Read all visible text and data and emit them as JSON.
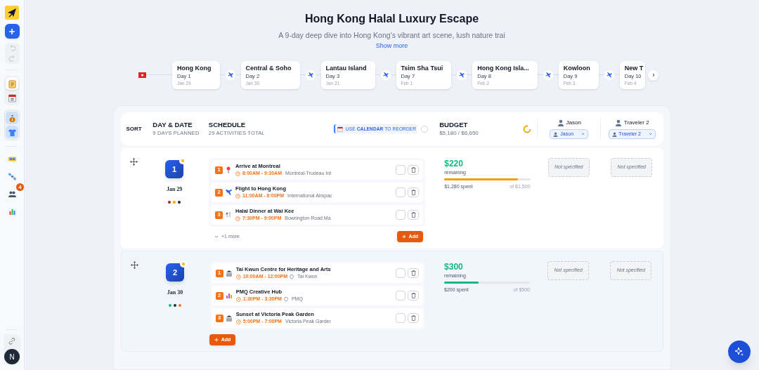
{
  "sidebar": {
    "history": [
      {
        "kind": "undo",
        "disabled": true
      },
      {
        "kind": "redo",
        "disabled": true
      }
    ],
    "views": [
      {
        "kind": "notes",
        "selected": true
      },
      {
        "kind": "calendar",
        "selected": false
      }
    ],
    "panels": [
      {
        "kind": "money",
        "selected": true
      },
      {
        "kind": "shirt",
        "selected": true
      }
    ],
    "tools": [
      {
        "kind": "tickets"
      },
      {
        "kind": "satellite"
      },
      {
        "kind": "people",
        "badge": "4"
      },
      {
        "kind": "chart"
      }
    ],
    "avatar": "N"
  },
  "trip": {
    "title": "Hong Kong Halal Luxury Escape",
    "description": "A 9-day deep dive into Hong Kong's vibrant art scene, lush nature trai",
    "show_more": "Show more"
  },
  "timeline": {
    "stops": [
      {
        "name": "Hong Kong",
        "day": "Day 1",
        "date": "Jan 29"
      },
      {
        "name": "Central & Soho",
        "day": "Day 2",
        "date": "Jan 30"
      },
      {
        "name": "Lantau Island",
        "day": "Day 3",
        "date": "Jan 31"
      },
      {
        "name": "Tsim Sha Tsui",
        "day": "Day 7",
        "date": "Feb 1"
      },
      {
        "name": "Hong Kong Isla...",
        "day": "Day 8",
        "date": "Feb 2"
      },
      {
        "name": "Kowloon",
        "day": "Day 9",
        "date": "Feb 3"
      },
      {
        "name": "New T",
        "day": "Day 10",
        "date": "Feb 4"
      }
    ]
  },
  "header": {
    "sort": "SORT",
    "day_title": "DAY & DATE",
    "day_sub": "9 DAYS PLANNED",
    "schedule_title": "SCHEDULE",
    "schedule_sub": "29 ACTIVITIES TOTAL",
    "calendar_hint": "USE **CALENDAR** TO REORDER",
    "calendar_toggle": false,
    "budget_title": "BUDGET",
    "budget_total": "$5,180 / $6,650",
    "travelers": [
      {
        "name": "Jason",
        "option": "Jason"
      },
      {
        "name": "Traveler 2",
        "option": "Traveler 2"
      }
    ]
  },
  "days": [
    {
      "number": "1",
      "date": "Jan 29",
      "highlighted": false,
      "dots": [
        {
          "color": "#b91c1c"
        },
        {
          "color": "#f59e0b"
        },
        {
          "color": "#1f2937"
        }
      ],
      "activities": [
        {
          "index": "1",
          "kind": "arrival",
          "title": "Arrive at Montreal",
          "time": "8:00AM - 9:30AM",
          "location": "Montréal-Trudeau Int",
          "pin": false,
          "done": false
        },
        {
          "index": "2",
          "kind": "flight",
          "title": "Flight to Hong Kong",
          "time": "11:00AM - 6:00PM",
          "location": "International Airspac",
          "pin": false,
          "done": false
        },
        {
          "index": "3",
          "kind": "dining",
          "title": "Halal Dinner at Wai Kee",
          "time": "7:30PM - 9:00PM",
          "location": "Bowrington Road Ma",
          "pin": false,
          "done": false
        }
      ],
      "more": "+1 more",
      "add": "Add",
      "budget": {
        "amount": "$220",
        "label": "remaining",
        "level": 0.853,
        "color": "#f59e0b",
        "spent": "$1,280 spent",
        "limit": "of $1,500"
      },
      "travelers": [
        "Not specified",
        "Not specified"
      ]
    },
    {
      "number": "2",
      "date": "Jan 30",
      "highlighted": true,
      "dots": [
        {
          "color": "#10b981"
        },
        {
          "color": "#1f2937"
        },
        {
          "color": "#f97316"
        }
      ],
      "activities": [
        {
          "index": "1",
          "kind": "museum",
          "title": "Tai Kwun Centre for Heritage and Arts",
          "time": "10:00AM - 12:00PM",
          "location": "Tai Kwun",
          "pin": true,
          "done": false
        },
        {
          "index": "2",
          "kind": "shopping",
          "title": "PMQ Creative Hub",
          "time": "1:30PM - 3:30PM",
          "location": "PMQ",
          "pin": true,
          "done": false
        },
        {
          "index": "3",
          "kind": "museum",
          "title": "Sunset at Victoria Peak Garden",
          "time": "5:00PM - 7:00PM",
          "location": "Victoria Peak Garder",
          "pin": false,
          "done": false
        }
      ],
      "add": "Add",
      "budget": {
        "amount": "$300",
        "label": "remaining",
        "level": 0.4,
        "color": "#10b981",
        "spent": "$200 spent",
        "limit": "of $500"
      },
      "travelers": [
        "Not specified",
        "Not specified"
      ]
    }
  ]
}
